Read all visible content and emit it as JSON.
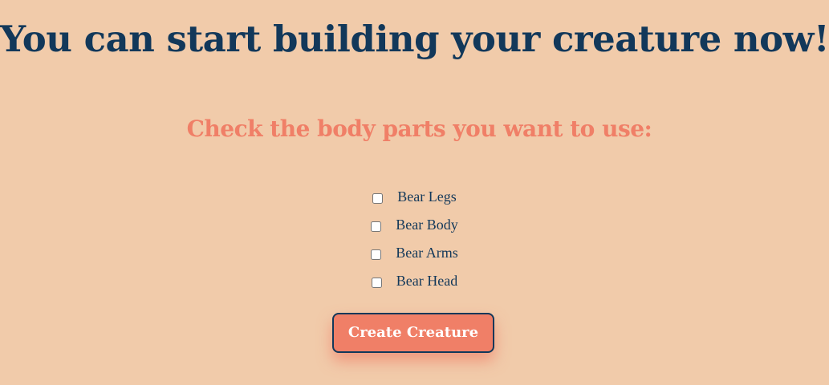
{
  "page": {
    "title": "You can start building your creature now!",
    "subtitle": "Check the body parts you want to use:"
  },
  "parts": [
    {
      "label": "Bear Legs",
      "checked": false
    },
    {
      "label": "Bear Body",
      "checked": false
    },
    {
      "label": "Bear Arms",
      "checked": false
    },
    {
      "label": "Bear Head",
      "checked": false
    }
  ],
  "actions": {
    "create_label": "Create Creature"
  },
  "colors": {
    "background": "#f1cbaa",
    "title": "#12385a",
    "accent": "#f07f67"
  }
}
